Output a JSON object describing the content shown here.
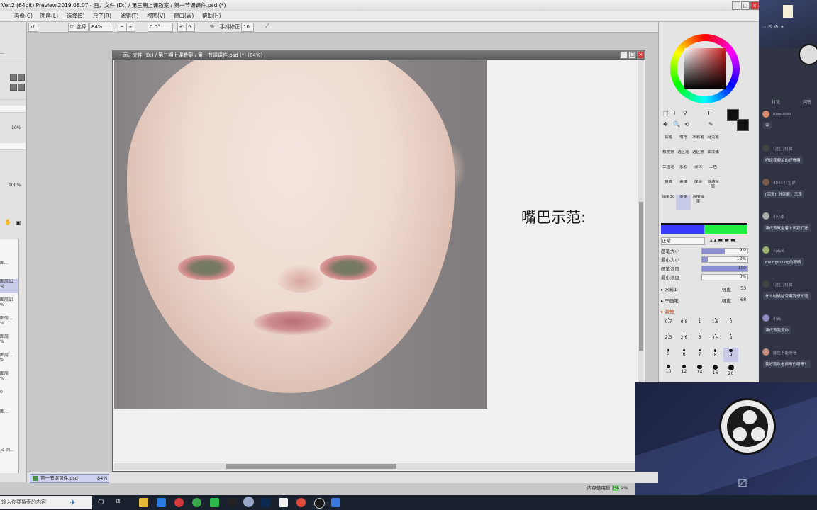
{
  "window": {
    "title": "Ver.2 (64bit) Preview.2019.08.07 - 画，文件 (D:) / 第三期上课教案 / 第一节课课件.psd (*)"
  },
  "menu": [
    "画像(C)",
    "图层(L)",
    "选择(S)",
    "尺子(R)",
    "滤镜(T)",
    "视图(V)",
    "窗口(W)",
    "帮助(H)"
  ],
  "toolbar": {
    "select_label": "选择",
    "zoom": "84%",
    "angle": "0.0°",
    "stabilizer_label": "手抖修正",
    "stabilizer_value": "10"
  },
  "left_panel": {
    "percent_a": "10%",
    "percent_b": "100%",
    "layers": [
      {
        "label": "图...",
        "selected": false
      },
      {
        "label": "图层12",
        "selected": true
      },
      {
        "label": "图层11",
        "selected": false
      },
      {
        "label": "图层...",
        "selected": false
      },
      {
        "label": "图层",
        "selected": false
      },
      {
        "label": "图层...",
        "selected": false
      },
      {
        "label": "图层",
        "selected": false
      },
      {
        "label": "0",
        "selected": false
      },
      {
        "label": "图...",
        "selected": false
      },
      {
        "label": "文 例...",
        "selected": false
      }
    ]
  },
  "document": {
    "title": "画，文件 (D:) / 第三期上课教案 / 第一节课课件.psd (*) (84%)",
    "caption": "嘴巴示范:",
    "tab_label": "第一节课课件.psd",
    "tab_zoom": "84%"
  },
  "right_panel": {
    "brush_tools": [
      "铅笔",
      "喷枪",
      "水彩笔",
      "马克笔",
      "橡皮擦",
      "选区笔",
      "选区擦",
      "油漆桶",
      "二值笔",
      "水彩",
      "涂抹",
      "上色",
      "模糊",
      "素描",
      "厚涂",
      "普通铅笔",
      "铅笔30",
      "墨笔",
      "素描铅笔"
    ],
    "selected_brush": "墨笔",
    "blend_mode": "正常",
    "props": [
      {
        "label": "画笔大小",
        "value": "9.0",
        "level": 0.5
      },
      {
        "label": "最小大小",
        "value": "12%",
        "level": 0.12
      },
      {
        "label": "画笔浓度",
        "value": "100",
        "level": 1.0
      },
      {
        "label": "最小浓度",
        "value": "0%",
        "level": 0.0
      }
    ],
    "texture_rows": [
      {
        "label": "水彩1",
        "name": "强度",
        "value": "53"
      },
      {
        "label": "干画笔",
        "name": "强度",
        "value": "68"
      }
    ],
    "other_label": "其他",
    "dot_sizes": [
      "0.7",
      "0.8",
      "1",
      "1.5",
      "2",
      "2.3",
      "2.6",
      "3",
      "3.5",
      "4",
      "5",
      "6",
      "7",
      "8",
      "9",
      "10",
      "12",
      "14",
      "16",
      "20"
    ],
    "selected_dot": "9",
    "primary_color": "#111111",
    "secondary_color": "#111111",
    "strip_colors": [
      "#3a3aff",
      "#22ee44"
    ]
  },
  "chat": {
    "tabs": [
      "讨论",
      "问答"
    ],
    "messages": [
      {
        "name": "rosepeau",
        "text": "😀",
        "avatar": "#d98a6c"
      },
      {
        "name": "打打打打猫",
        "text": "听说视频拍的好看啊",
        "avatar": "#444444"
      },
      {
        "name": "404444拉萨",
        "text": "[回复]: 外回复。三段",
        "avatar": "#7a5a4a"
      },
      {
        "name": "小小雨",
        "text": "课代表就坐着上面我们还",
        "avatar": "#aaaaaa"
      },
      {
        "name": "石石头",
        "text": "bulingbuling的眼睛",
        "avatar": "#9bb06c"
      },
      {
        "name": "打打打打猫",
        "text": "什么时候结束啊我想知道",
        "avatar": "#444444"
      },
      {
        "name": "小画",
        "text": "课代表我爱你",
        "avatar": "#8a8abf"
      },
      {
        "name": "能在不能睡吧",
        "text": "我好喜欢老师画的眼睛！",
        "avatar": "#c58b7a"
      }
    ]
  },
  "status": {
    "memory_label": "内存使用量",
    "memory_value": "2%",
    "memory_extra": "9%"
  },
  "taskbar": {
    "search_placeholder": "输入你要搜索的内容"
  }
}
